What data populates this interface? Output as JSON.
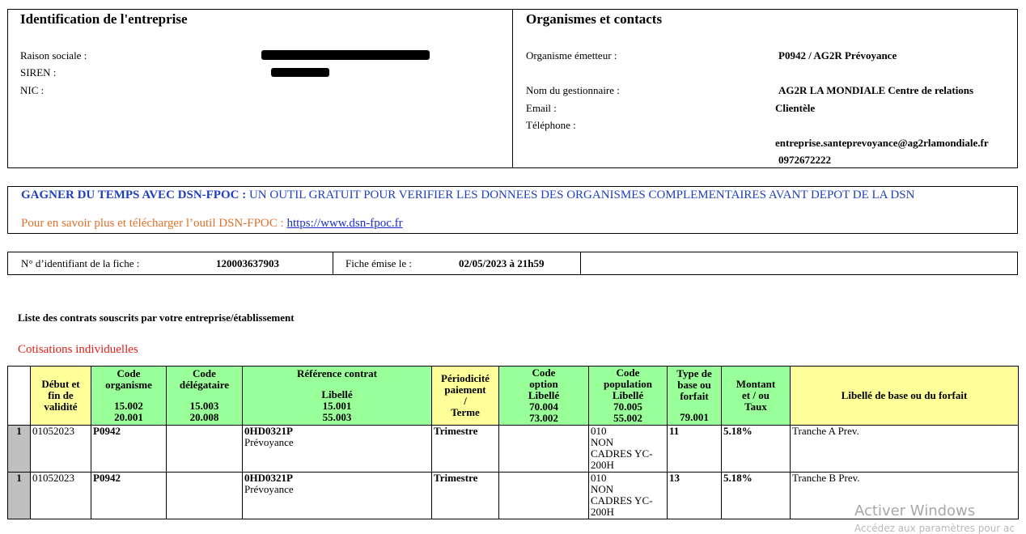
{
  "company": {
    "title": "Identification de l'entreprise",
    "raison_sociale_label": "Raison sociale :",
    "siren_label": "SIREN :",
    "nic_label": "NIC :"
  },
  "contacts": {
    "title": "Organismes et contacts",
    "emetteur_label": "Organisme émetteur :",
    "emetteur_value": "P0942 / AG2R Prévoyance",
    "gestionnaire_label": "Nom du gestionnaire :",
    "gestionnaire_line1": "AG2R LA MONDIALE Centre de relations",
    "gestionnaire_line2": "Clientèle",
    "email_label": "Email :",
    "telephone_label": "Téléphone :",
    "email_value": "entreprise.santeprevoyance@ag2rlamondiale.fr",
    "telephone_value": "0972672222"
  },
  "banner": {
    "headline_bold": "GAGNER DU TEMPS AVEC DSN-FPOC :",
    "headline_rest": " UN OUTIL GRATUIT POUR VERIFIER LES DONNEES DES ORGANISMES COMPLEMENTAIRES AVANT DEPOT DE LA DSN",
    "info_text": "Pour en savoir plus et télécharger l’outil DSN-FPOC : ",
    "link_text": "https://www.dsn-fpoc.fr"
  },
  "fiche": {
    "id_label": "N° d’identifiant de la fiche :",
    "id_value": "120003637903",
    "emise_label": "Fiche émise le :",
    "emise_value": "02/05/2023 à 21h59"
  },
  "section_title": "Liste des contrats souscrits par votre entreprise/établissement",
  "cotisations_title": "Cotisations individuelles",
  "table": {
    "headers": {
      "debut": [
        "Début et",
        "fin de",
        "validité"
      ],
      "code_org": [
        "Code",
        "organisme",
        "",
        "15.002",
        "20.001"
      ],
      "code_deleg": [
        "Code",
        "délégataire",
        "",
        "15.003",
        "20.008"
      ],
      "ref": [
        "Référence contrat",
        "",
        "Libellé",
        "15.001",
        "55.003"
      ],
      "periodicite": [
        "Périodicité",
        "paiement",
        "/",
        "Terme"
      ],
      "option": [
        "Code",
        "option",
        "Libellé",
        "70.004",
        "73.002"
      ],
      "population": [
        "Code",
        "population",
        "Libellé",
        "70.005",
        "55.002"
      ],
      "type": [
        "Type de",
        "base ou",
        "forfait",
        "",
        "79.001"
      ],
      "montant": [
        "Montant",
        "et / ou",
        "Taux"
      ],
      "libelle_base": "Libellé de base ou du forfait"
    },
    "rows": [
      {
        "idx": "1",
        "date": "01052023",
        "organisme": "P0942",
        "delegataire": "",
        "ref_code": "0HD0321P",
        "ref_label": "Prévoyance",
        "periodicite": "Trimestre",
        "option": "",
        "pop_code": "010",
        "pop_l1": "NON",
        "pop_l2": "CADRES YC-",
        "pop_l3": "200H",
        "type": "11",
        "taux": "5.18%",
        "libelle": "Tranche A Prev."
      },
      {
        "idx": "1",
        "date": "01052023",
        "organisme": "P0942",
        "delegataire": "",
        "ref_code": "0HD0321P",
        "ref_label": "Prévoyance",
        "periodicite": "Trimestre",
        "option": "",
        "pop_code": "010",
        "pop_l1": "NON",
        "pop_l2": "CADRES YC-",
        "pop_l3": "200H",
        "type": "13",
        "taux": "5.18%",
        "libelle": "Tranche B Prev."
      }
    ]
  },
  "watermark": {
    "line1": "Activer Windows",
    "line2": "Accédez aux paramètres pour ac"
  },
  "colors": {
    "banner_blue": "#1f3fbf",
    "info_orange": "#e0702a",
    "section_red": "#e0201a",
    "header_yellow": "#ffff99",
    "header_green": "#99ff99",
    "index_gray": "#c0c0c0"
  }
}
